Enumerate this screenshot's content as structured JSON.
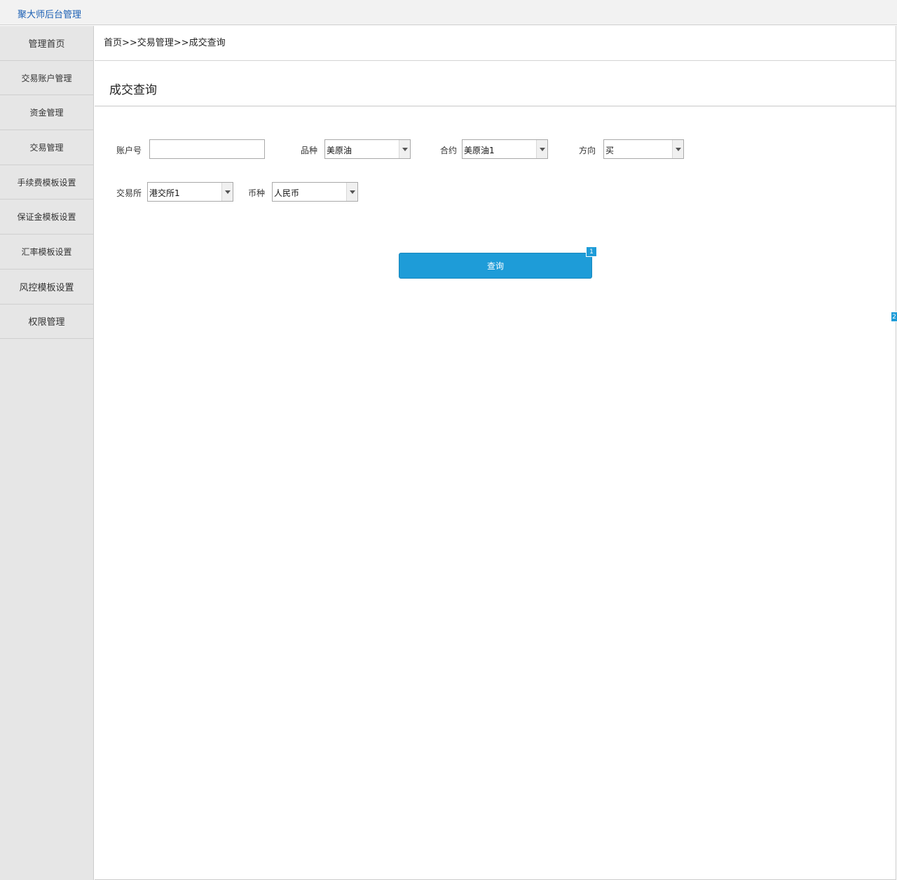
{
  "app": {
    "title": "聚大师后台管理"
  },
  "sidebar": {
    "items": [
      {
        "label": "管理首页"
      },
      {
        "label": "交易账户管理"
      },
      {
        "label": "资金管理"
      },
      {
        "label": "交易管理"
      },
      {
        "label": "手续费模板设置"
      },
      {
        "label": "保证金模板设置"
      },
      {
        "label": "汇率模板设置"
      },
      {
        "label": "风控模板设置"
      },
      {
        "label": "权限管理"
      }
    ]
  },
  "breadcrumb": "首页>>交易管理>>成交查询",
  "page_title": "成交查询",
  "form": {
    "account": {
      "label": "账户号",
      "value": ""
    },
    "variety": {
      "label": "品种",
      "value": "美原油"
    },
    "contract": {
      "label": "合约",
      "value": "美原油1"
    },
    "direction": {
      "label": "方向",
      "value": "买"
    },
    "exchange": {
      "label": "交易所",
      "value": "港交所1"
    },
    "currency": {
      "label": "币种",
      "value": "人民币"
    }
  },
  "query_button": {
    "label": "查询"
  },
  "badges": {
    "query_badge": "1",
    "edge_badge": "2"
  },
  "colors": {
    "accent": "#1e9cd8",
    "title": "#1a5fb4",
    "sidebar_bg": "#e6e6e6"
  }
}
